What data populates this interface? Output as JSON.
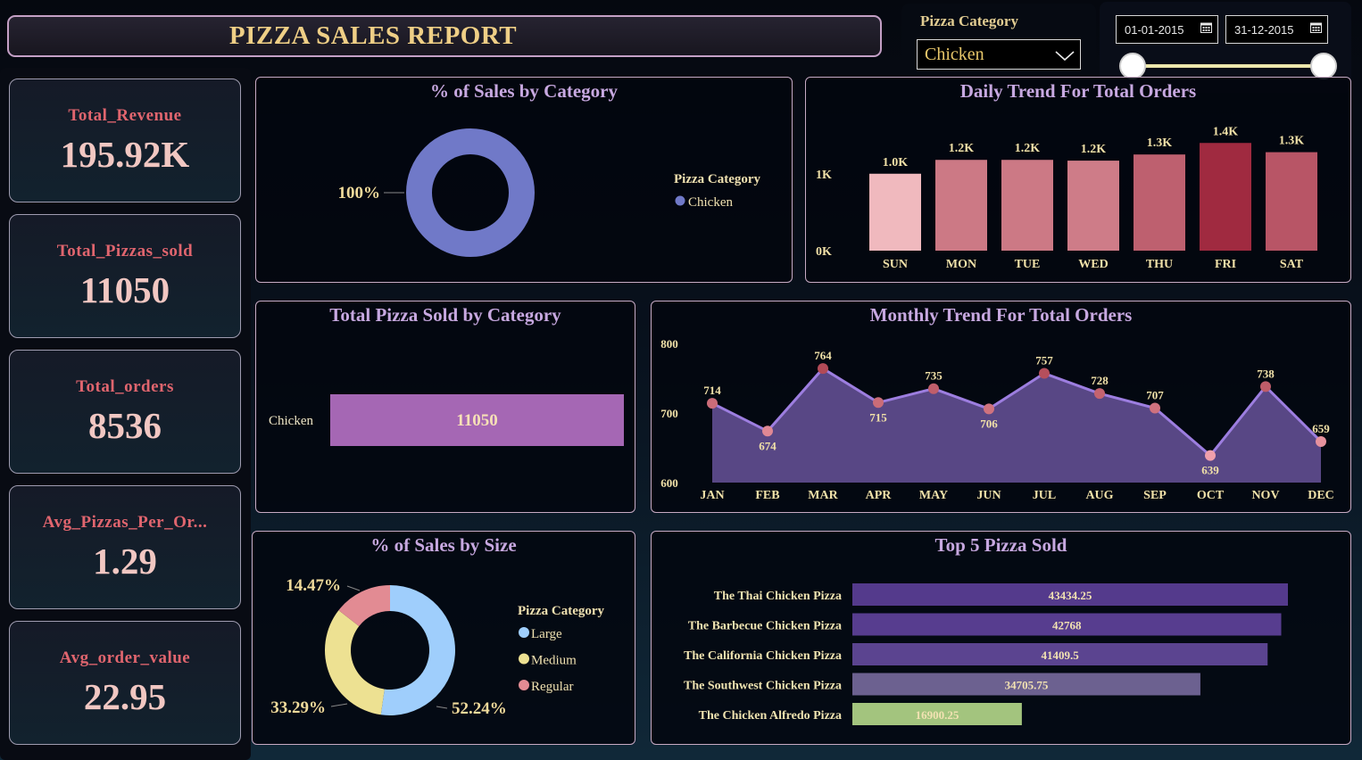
{
  "header": {
    "title": "PIZZA SALES REPORT"
  },
  "filters": {
    "category_label": "Pizza Category",
    "category_value": "Chicken",
    "date_start": "01-01-2015",
    "date_end": "31-12-2015",
    "slider": {
      "start_fraction": 0,
      "end_fraction": 1
    }
  },
  "kpis": [
    {
      "label": "Total_Revenue",
      "value": "195.92K"
    },
    {
      "label": "Total_Pizzas_sold",
      "value": "11050"
    },
    {
      "label": "Total_orders",
      "value": "8536"
    },
    {
      "label": "Avg_Pizzas_Per_Or...",
      "value": "1.29"
    },
    {
      "label": "Avg_order_value",
      "value": "22.95"
    }
  ],
  "colors": {
    "title_gold": "#efcf86",
    "kpi_label": "#e0656e",
    "kpi_value": "#f1c7c2",
    "card_title": "#c7a8e0",
    "donut_blue": "#7079c8",
    "bar_purple": "#a567b4",
    "area_fill": "#5d4b8c",
    "line": "#9d7ee0",
    "marker": "#b24a57",
    "large": "#9fcefc",
    "medium": "#ede192",
    "regular": "#e28b93"
  },
  "chart_data": [
    {
      "type": "pie",
      "title": "% of Sales by Category",
      "legend_title": "Pizza Category",
      "categories": [
        "Chicken"
      ],
      "values": [
        100
      ],
      "labels": [
        "100%"
      ],
      "legend_position": "right"
    },
    {
      "type": "bar",
      "title": "Daily Trend For Total Orders",
      "categories": [
        "SUN",
        "MON",
        "TUE",
        "WED",
        "THU",
        "FRI",
        "SAT"
      ],
      "values": [
        1000,
        1180,
        1180,
        1170,
        1250,
        1400,
        1280
      ],
      "value_labels": [
        "1.0K",
        "1.2K",
        "1.2K",
        "1.2K",
        "1.3K",
        "1.4K",
        "1.3K"
      ],
      "ylim": [
        0,
        1600
      ],
      "yticks": [
        0,
        1000
      ],
      "ytick_labels": [
        "0K",
        "1K"
      ]
    },
    {
      "type": "bar",
      "orientation": "horizontal",
      "title": "Total Pizza Sold by Category",
      "categories": [
        "Chicken"
      ],
      "values": [
        11050
      ],
      "value_labels": [
        "11050"
      ]
    },
    {
      "type": "area",
      "title": "Monthly Trend For Total Orders",
      "x": [
        "JAN",
        "FEB",
        "MAR",
        "APR",
        "MAY",
        "JUN",
        "JUL",
        "AUG",
        "SEP",
        "OCT",
        "NOV",
        "DEC"
      ],
      "values": [
        714,
        674,
        764,
        715,
        735,
        706,
        757,
        728,
        707,
        639,
        738,
        659
      ],
      "ylim": [
        600,
        800
      ],
      "yticks": [
        600,
        700,
        800
      ]
    },
    {
      "type": "pie",
      "title": "% of Sales by Size",
      "legend_title": "Pizza Category",
      "categories": [
        "Large",
        "Medium",
        "Regular"
      ],
      "values": [
        52.24,
        33.29,
        14.47
      ],
      "labels": [
        "52.24%",
        "33.29%",
        "14.47%"
      ],
      "legend_position": "right"
    },
    {
      "type": "bar",
      "orientation": "horizontal",
      "title": "Top 5 Pizza Sold",
      "categories": [
        "The Thai Chicken Pizza",
        "The Barbecue Chicken Pizza",
        "The California Chicken Pizza",
        "The Southwest Chicken Pizza",
        "The Chicken Alfredo Pizza"
      ],
      "values": [
        43434.25,
        42768,
        41409.5,
        34705.75,
        16900.25
      ],
      "value_labels": [
        "43434.25",
        "42768",
        "41409.5",
        "34705.75",
        "16900.25"
      ]
    }
  ]
}
